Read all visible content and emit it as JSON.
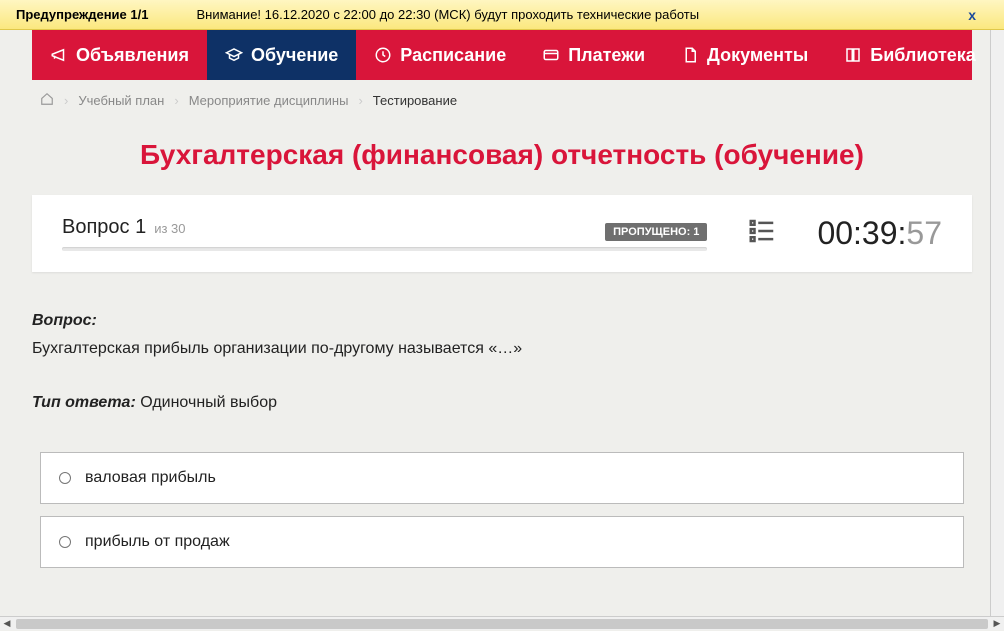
{
  "warning": {
    "label": "Предупреждение 1/1",
    "text": "Внимание! 16.12.2020 с 22:00 до 22:30 (МСК) будут проходить технические работы",
    "close": "x"
  },
  "nav": {
    "items": [
      {
        "label": "Объявления",
        "icon": "megaphone-icon",
        "active": false
      },
      {
        "label": "Обучение",
        "icon": "education-icon",
        "active": true
      },
      {
        "label": "Расписание",
        "icon": "clock-icon",
        "active": false
      },
      {
        "label": "Платежи",
        "icon": "card-icon",
        "active": false
      },
      {
        "label": "Документы",
        "icon": "document-icon",
        "active": false
      },
      {
        "label": "Библиотека",
        "icon": "book-icon",
        "active": false,
        "chevron": true
      }
    ]
  },
  "breadcrumb": {
    "items": [
      {
        "label": "Учебный план"
      },
      {
        "label": "Мероприятие дисциплины"
      },
      {
        "label": "Тестирование",
        "current": true
      }
    ]
  },
  "title": "Бухгалтерская (финансовая) отчетность (обучение)",
  "card": {
    "question_word": "Вопрос 1",
    "of_total": "из 30",
    "missed": "ПРОПУЩЕНО: 1",
    "timer_main": "00:39:",
    "timer_sec": "57"
  },
  "question": {
    "label": "Вопрос:",
    "text": "Бухгалтерская прибыль организации по-другому называется «…»",
    "ans_type_label": "Тип ответа:",
    "ans_type": " Одиночный выбор"
  },
  "answers": [
    {
      "text": "валовая прибыль"
    },
    {
      "text": "прибыль от продаж"
    }
  ]
}
